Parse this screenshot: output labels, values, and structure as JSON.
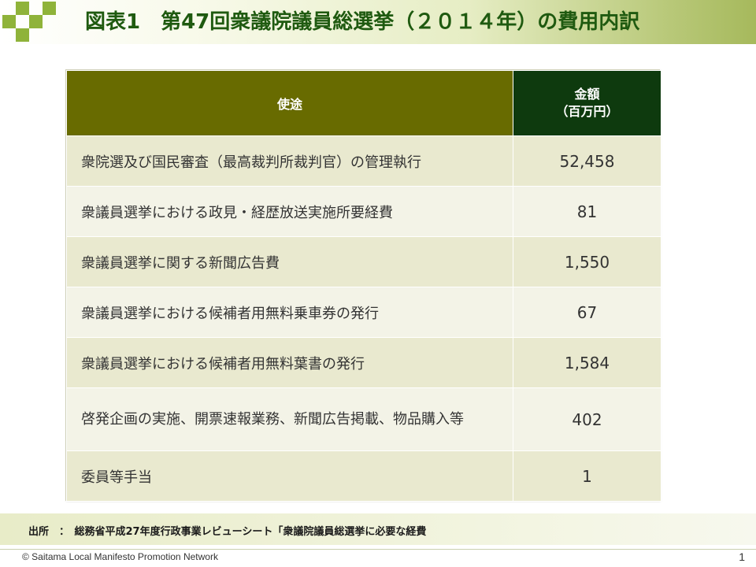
{
  "slide": {
    "title": "図表1　第47回衆議院議員総選挙（２０１４年）の費用内訳",
    "brand_color": "#8fb33a"
  },
  "table": {
    "headers": {
      "use": "使途",
      "amount_line1": "金額",
      "amount_line2": "（百万円）"
    },
    "rows": [
      {
        "use": "衆院選及び国民審査（最高裁判所裁判官）の管理執行",
        "amount": "52,458"
      },
      {
        "use": "衆議員選挙における政見・経歴放送実施所要経費",
        "amount": "81"
      },
      {
        "use": "衆議員選挙に関する新聞広告費",
        "amount": "1,550"
      },
      {
        "use": "衆議員選挙における候補者用無料乗車券の発行",
        "amount": "67"
      },
      {
        "use": "衆議員選挙における候補者用無料葉書の発行",
        "amount": "1,584"
      },
      {
        "use": "啓発企画の実施、開票速報業務、新聞広告掲載、物品購入等",
        "amount": "402"
      },
      {
        "use": "委員等手当",
        "amount": "1"
      }
    ]
  },
  "source": "出所　：　総務省平成27年度行政事業レビューシート「衆議院議員総選挙に必要な経費",
  "footer": {
    "copyright": "© Saitama Local Manifesto Promotion Network",
    "page": "1"
  }
}
